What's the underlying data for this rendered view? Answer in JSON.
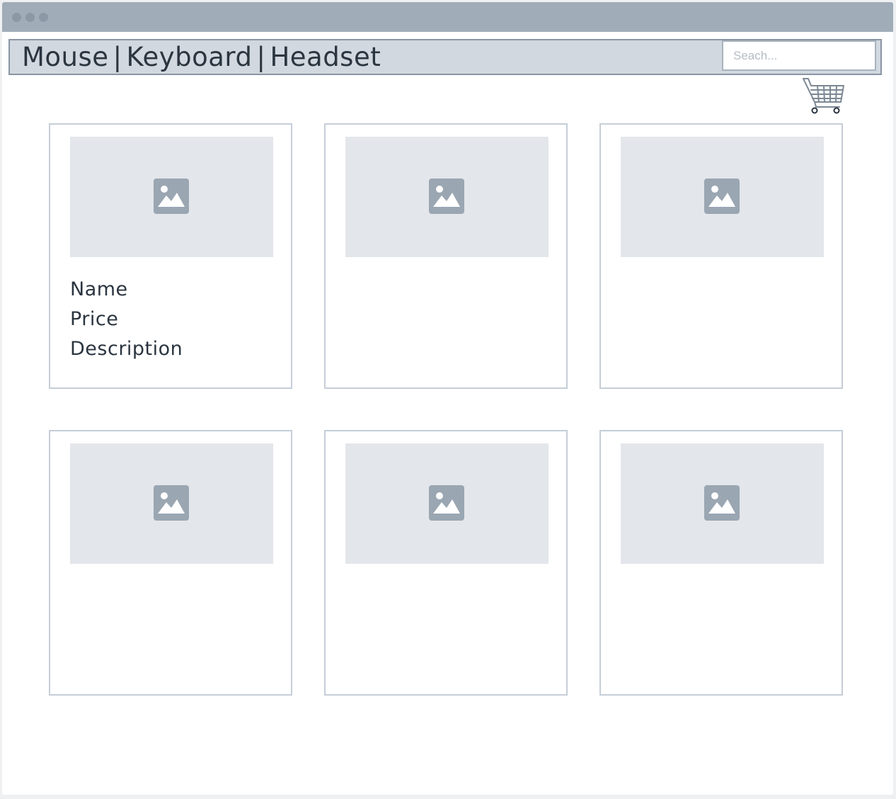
{
  "nav": {
    "links": [
      "Mouse",
      "Keyboard",
      "Headset"
    ],
    "separator": "|"
  },
  "search": {
    "value": "",
    "placeholder": "Seach..."
  },
  "cart": {
    "icon": "cart-icon"
  },
  "products": [
    {
      "image_icon": "image-placeholder-icon",
      "name": "Name",
      "price": "Price",
      "description": "Description"
    },
    {
      "image_icon": "image-placeholder-icon"
    },
    {
      "image_icon": "image-placeholder-icon"
    },
    {
      "image_icon": "image-placeholder-icon"
    },
    {
      "image_icon": "image-placeholder-icon"
    },
    {
      "image_icon": "image-placeholder-icon"
    }
  ],
  "colors": {
    "titlebar": "#a0acb8",
    "navbar": "#d1d8df",
    "card_border": "#c5ced7",
    "placeholder_bg": "#e3e6ea",
    "placeholder_icon": "#9aa6b2",
    "text": "#2b3540"
  }
}
